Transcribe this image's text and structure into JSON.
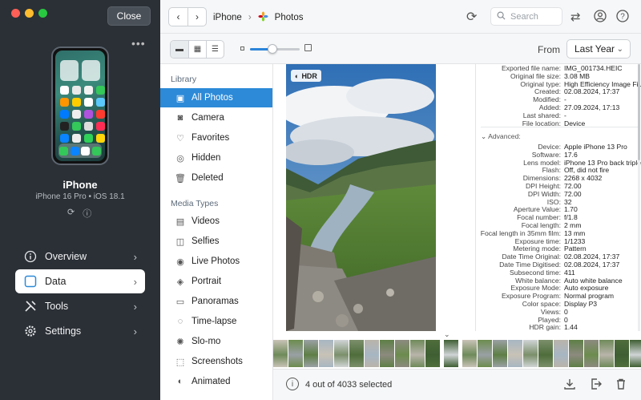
{
  "device_panel": {
    "close_label": "Close",
    "device_name": "iPhone",
    "device_model": "iPhone 16 Pro • iOS 18.1",
    "nav": [
      {
        "label": "Overview",
        "icon": "info-circle-icon"
      },
      {
        "label": "Data",
        "icon": "square-icon"
      },
      {
        "label": "Tools",
        "icon": "tools-icon"
      },
      {
        "label": "Settings",
        "icon": "gear-icon"
      }
    ]
  },
  "toolbar": {
    "breadcrumb": [
      "iPhone",
      "Photos"
    ],
    "search_placeholder": "Search"
  },
  "subtoolbar": {
    "from_label": "From",
    "from_value": "Last Year",
    "thumb_size": 0.45
  },
  "library": {
    "section_library": "Library",
    "library_items": [
      {
        "label": "All Photos",
        "icon": "photos-icon"
      },
      {
        "label": "Camera",
        "icon": "camera-icon"
      },
      {
        "label": "Favorites",
        "icon": "heart-icon"
      },
      {
        "label": "Hidden",
        "icon": "eye-slash-icon"
      },
      {
        "label": "Deleted",
        "icon": "trash-icon"
      }
    ],
    "section_media": "Media Types",
    "media_items": [
      {
        "label": "Videos",
        "icon": "film-icon"
      },
      {
        "label": "Selfies",
        "icon": "person-icon"
      },
      {
        "label": "Live Photos",
        "icon": "live-icon"
      },
      {
        "label": "Portrait",
        "icon": "cube-icon"
      },
      {
        "label": "Panoramas",
        "icon": "panorama-icon"
      },
      {
        "label": "Time-lapse",
        "icon": "timelapse-icon"
      },
      {
        "label": "Slo-mo",
        "icon": "slomo-icon"
      },
      {
        "label": "Screenshots",
        "icon": "screenshot-icon"
      },
      {
        "label": "Animated",
        "icon": "animated-icon"
      }
    ]
  },
  "photo": {
    "badge": "HDR"
  },
  "info": {
    "general": [
      {
        "k": "Exported file name:",
        "v": "IMG_001734.HEIC"
      },
      {
        "k": "Original file size:",
        "v": "3.08 MB"
      },
      {
        "k": "Original type:",
        "v": "High Efficiency Image Fil..."
      },
      {
        "k": "Created:",
        "v": "02.08.2024, 17:37"
      },
      {
        "k": "Modified:",
        "v": "-"
      },
      {
        "k": "Added:",
        "v": "27.09.2024, 17:13"
      },
      {
        "k": "Last shared:",
        "v": "-"
      },
      {
        "k": "File location:",
        "v": "Device"
      }
    ],
    "advanced_label": "Advanced:",
    "advanced": [
      {
        "k": "Device:",
        "v": "Apple iPhone 13 Pro"
      },
      {
        "k": "Software:",
        "v": "17.6"
      },
      {
        "k": "Lens model:",
        "v": "iPhone 13 Pro back triple..."
      },
      {
        "k": "Flash:",
        "v": "Off, did not fire"
      },
      {
        "k": "Dimensions:",
        "v": "2268 x 4032"
      },
      {
        "k": "DPI Height:",
        "v": "72.00"
      },
      {
        "k": "DPI Width:",
        "v": "72.00"
      },
      {
        "k": "ISO:",
        "v": "32"
      },
      {
        "k": "Aperture Value:",
        "v": "1.70"
      },
      {
        "k": "Focal number:",
        "v": "f/1.8"
      },
      {
        "k": "Focal length:",
        "v": "2 mm"
      },
      {
        "k": "Focal length in 35mm film:",
        "v": "13 mm"
      },
      {
        "k": "Exposure time:",
        "v": "1/1233"
      },
      {
        "k": "Metering mode:",
        "v": "Pattern"
      },
      {
        "k": "Date Time Original:",
        "v": "02.08.2024, 17:37"
      },
      {
        "k": "Date Time Digitised:",
        "v": "02.08.2024, 17:37"
      },
      {
        "k": "Subsecond time:",
        "v": "411"
      },
      {
        "k": "White balance:",
        "v": "Auto white balance"
      },
      {
        "k": "Exposure Mode:",
        "v": "Auto exposure"
      },
      {
        "k": "Exposure Program:",
        "v": "Normal program"
      },
      {
        "k": "Color space:",
        "v": "Display P3"
      },
      {
        "k": "Views:",
        "v": "0"
      },
      {
        "k": "Played:",
        "v": "0"
      },
      {
        "k": "HDR gain:",
        "v": "1.44"
      }
    ]
  },
  "status": {
    "selection": "4 out of 4033 selected"
  },
  "colors": {
    "accent": "#2c8ad8",
    "panel_dark": "#2b3036"
  }
}
